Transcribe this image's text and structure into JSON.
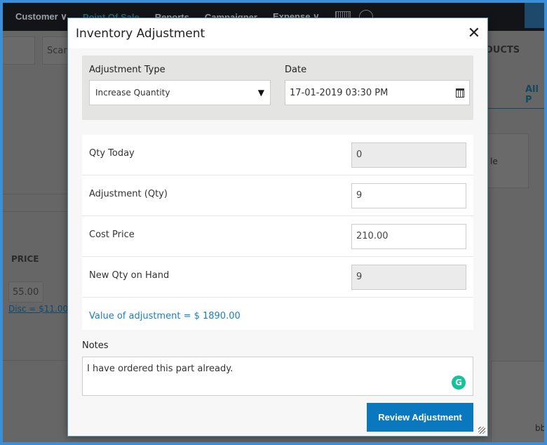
{
  "nav": {
    "items": [
      "Customer ∨",
      "Point Of Sale",
      "Reports",
      "Campaigner",
      "Expense ∨"
    ]
  },
  "background": {
    "scan_placeholder": "Scan",
    "products_tab": "DUCTS",
    "all_tab": "All P",
    "price_header": "PRICE",
    "price_value": "55.00",
    "disc_link": "Disc = $11.00",
    "partial_text": "le",
    "partial_text2": "bb"
  },
  "modal": {
    "title": "Inventory Adjustment",
    "close": "✕",
    "adjustment_type_label": "Adjustment Type",
    "adjustment_type_value": "Increase Quantity",
    "date_label": "Date",
    "date_value": "17-01-2019 03:30 PM",
    "rows": [
      {
        "label": "Qty Today",
        "value": "0",
        "readonly": true
      },
      {
        "label": "Adjustment (Qty)",
        "value": "9",
        "readonly": false
      },
      {
        "label": "Cost Price",
        "value": "210.00",
        "readonly": false
      },
      {
        "label": "New Qty on Hand",
        "value": "9",
        "readonly": true
      }
    ],
    "value_text": "Value of adjustment = $ 1890.00",
    "notes_label": "Notes",
    "notes_value": "I have ordered this part already.",
    "review_button": "Review Adjustment"
  }
}
